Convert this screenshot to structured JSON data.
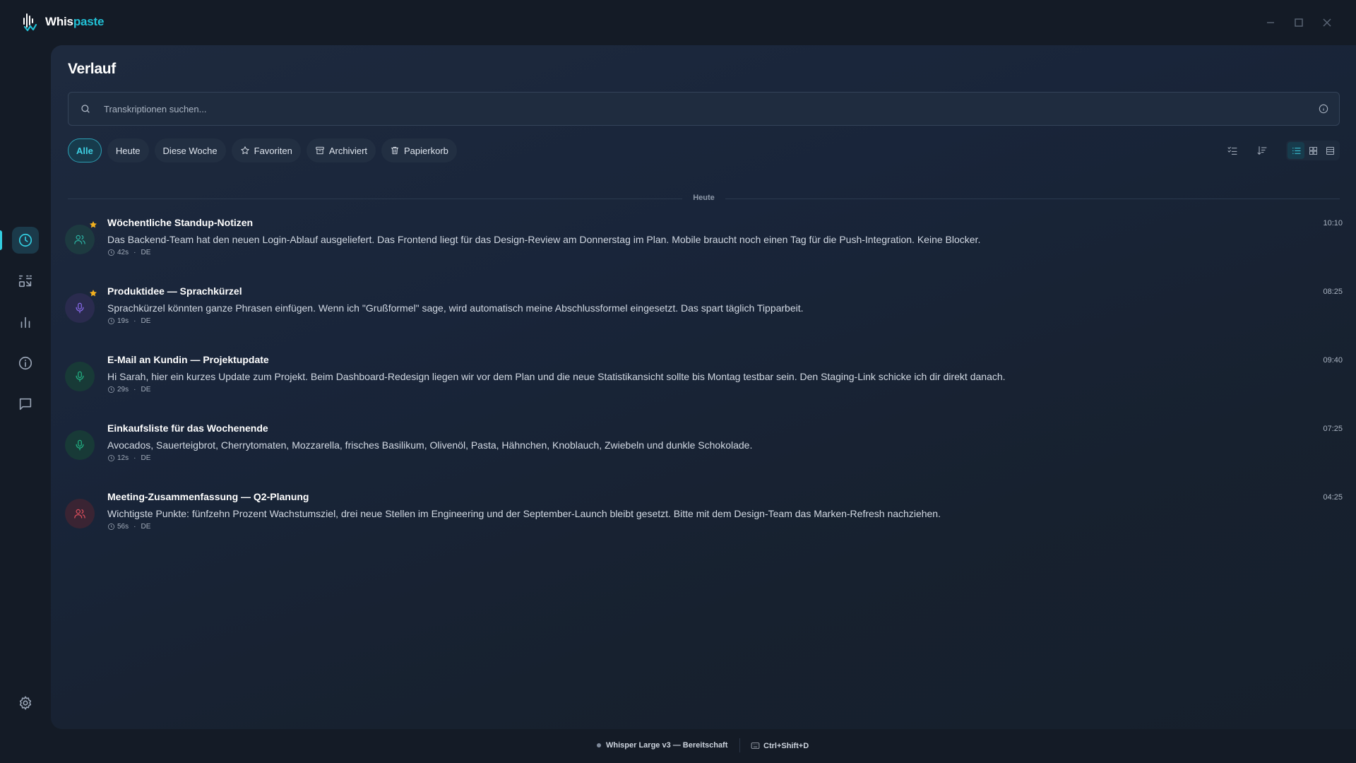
{
  "app": {
    "name_part1": "Whis",
    "name_part2": "paste",
    "accent": "#22c1d6"
  },
  "window_controls": {
    "minimize": "minimize-icon",
    "maximize": "maximize-icon",
    "close": "close-icon"
  },
  "sidebar": {
    "items": [
      {
        "icon": "history-clock-icon",
        "active": true
      },
      {
        "icon": "shortcuts-icon",
        "active": false
      },
      {
        "icon": "statistics-bar-chart-icon",
        "active": false
      },
      {
        "icon": "info-icon",
        "active": false
      },
      {
        "icon": "feedback-message-icon",
        "active": false
      }
    ],
    "bottom": {
      "icon": "settings-gear-icon"
    }
  },
  "page": {
    "title": "Verlauf"
  },
  "search": {
    "placeholder": "Transkriptionen suchen...",
    "value": ""
  },
  "filters": [
    {
      "label": "Alle",
      "active": true,
      "icon": ""
    },
    {
      "label": "Heute",
      "active": false,
      "icon": ""
    },
    {
      "label": "Diese Woche",
      "active": false,
      "icon": ""
    },
    {
      "label": "Favoriten",
      "active": false,
      "icon": "star-icon"
    },
    {
      "label": "Archiviert",
      "active": false,
      "icon": "archive-icon"
    },
    {
      "label": "Papierkorb",
      "active": false,
      "icon": "trash-icon"
    }
  ],
  "toolbar": {
    "select_icon": "multi-select-icon",
    "sort_icon": "sort-icon",
    "views": [
      {
        "icon": "list-view-icon",
        "active": true
      },
      {
        "icon": "grid-view-icon",
        "active": false
      },
      {
        "icon": "compact-view-icon",
        "active": false
      }
    ]
  },
  "group_label": "Heute",
  "entries": [
    {
      "title": "Wöchentliche Standup-Notizen",
      "text": "Das Backend-Team hat den neuen Login-Ablauf ausgeliefert. Das Frontend liegt für das Design-Review am Donnerstag im Plan. Mobile braucht noch einen Tag für die Push-Integration. Keine Blocker.",
      "duration": "42s",
      "lang": "DE",
      "time": "10:10",
      "favorite": true,
      "icon": "users-icon",
      "color": "#2bb3a3",
      "bg": "#1d3a40"
    },
    {
      "title": "Produktidee — Sprachkürzel",
      "text": "Sprachkürzel könnten ganze Phrasen einfügen. Wenn ich \"Grußformel\" sage, wird automatisch meine Abschlussformel eingesetzt. Das spart täglich Tipparbeit.",
      "duration": "19s",
      "lang": "DE",
      "time": "08:25",
      "favorite": true,
      "icon": "microphone-icon",
      "color": "#8b6cf0",
      "bg": "#2a2b4e"
    },
    {
      "title": "E-Mail an Kundin — Projektupdate",
      "text": "Hi Sarah, hier ein kurzes Update zum Projekt. Beim Dashboard-Redesign liegen wir vor dem Plan und die neue Statistikansicht sollte bis Montag testbar sein. Den Staging-Link schicke ich dir direkt danach.",
      "duration": "29s",
      "lang": "DE",
      "time": "09:40",
      "favorite": false,
      "icon": "microphone-icon",
      "color": "#22b585",
      "bg": "#183a37"
    },
    {
      "title": "Einkaufsliste für das Wochenende",
      "text": "Avocados, Sauerteigbrot, Cherrytomaten, Mozzarella, frisches Basilikum, Olivenöl, Pasta, Hähnchen, Knoblauch, Zwiebeln und dunkle Schokolade.",
      "duration": "12s",
      "lang": "DE",
      "time": "07:25",
      "favorite": false,
      "icon": "microphone-icon",
      "color": "#22b585",
      "bg": "#183a37"
    },
    {
      "title": "Meeting-Zusammenfassung — Q2-Planung",
      "text": "Wichtigste Punkte: fünfzehn Prozent Wachstumsziel, drei neue Stellen im Engineering und der September-Launch bleibt gesetzt. Bitte mit dem Design-Team das Marken-Refresh nachziehen.",
      "duration": "56s",
      "lang": "DE",
      "time": "04:25",
      "favorite": false,
      "icon": "users-icon",
      "color": "#e0505e",
      "bg": "#3a2433"
    }
  ],
  "statusbar": {
    "model": "Whisper Large v3 — Bereitschaft",
    "hotkey": "Ctrl+Shift+D"
  }
}
